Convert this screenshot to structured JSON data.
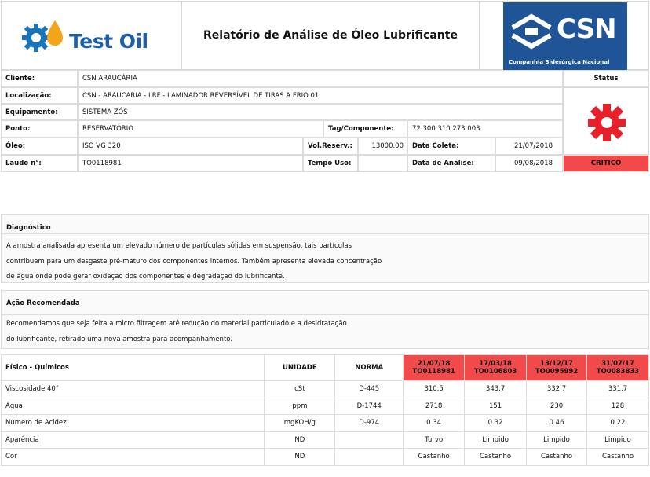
{
  "header": {
    "logo_text": "Test Oil",
    "title": "Relatório de Análise de Óleo Lubrificante",
    "csn_logo_text": "CSN",
    "csn_subtitle": "Companhia Siderúrgica Nacional"
  },
  "info": {
    "cliente_label": "Cliente:",
    "cliente_value": "CSN ARAUCÁRIA",
    "localizacao_label": "Localização:",
    "localizacao_value": "CSN - ARAUCARIA  - LRF - LAMINADOR REVERSÍVEL DE TIRAS A FRIO 01",
    "equipamento_label": "Equipamento:",
    "equipamento_value": "SISTEMA ZÓS",
    "ponto_label": "Ponto:",
    "ponto_value": "RESERVATÓRIO",
    "tag_label": "Tag/Componente:",
    "tag_value": "72 300 310 273 003",
    "oleo_label": "Óleo:",
    "oleo_value": "ISO VG 320",
    "volreserv_label": "Vol.Reserv.:",
    "volreserv_value": "13000.00",
    "data_coleta_label": "Data Coleta:",
    "data_coleta_value": "21/07/2018",
    "laudo_label": "Laudo n°:",
    "laudo_value": "TO0118981",
    "tempo_uso_label": "Tempo Uso:",
    "tempo_uso_value": "",
    "data_analise_label": "Data de Análise:",
    "data_analise_value": "09/08/2018",
    "status_label": "Status",
    "status_value": "CRITICO",
    "status_color": "#f24a4a"
  },
  "diagnostico": {
    "title": "Diagnóstico",
    "text": "A amostra analisada apresenta um elevado número de partículas sólidas em suspensão, tais partículas\ncontribuem para um desgaste pré-maturo dos componentes internos. Também apresenta elevada concentração\nde água onde pode gerar oxidação dos componentes e degradação do lubrificante."
  },
  "acao": {
    "title": "Ação Recomendada",
    "text": "Recomendamos que seja feita a micro filtragem até redução do material particulado e a desidratação\ndo lubrificante, retirado uma nova amostra para acompanhamento."
  },
  "results": {
    "col_param": "Físico - Químicos",
    "col_unit": "UNIDADE",
    "col_norm": "NORMA",
    "samples": [
      {
        "date": "21/07/18",
        "laudo": "TO0118981"
      },
      {
        "date": "17/03/18",
        "laudo": "TO0106803"
      },
      {
        "date": "13/12/17",
        "laudo": "TO0095992"
      },
      {
        "date": "31/07/17",
        "laudo": "TO0083833"
      }
    ],
    "rows": [
      {
        "name": "Viscosidade 40°",
        "unit": "cSt",
        "norm": "D-445",
        "values": [
          "310.5",
          "343.7",
          "332.7",
          "331.7"
        ]
      },
      {
        "name": "Água",
        "unit": "ppm",
        "norm": "D-1744",
        "values": [
          "2718",
          "151",
          "230",
          "128"
        ]
      },
      {
        "name": "Número de Acidez",
        "unit": "mgKOH/g",
        "norm": "D-974",
        "values": [
          "0.34",
          "0.32",
          "0.46",
          "0.22"
        ]
      },
      {
        "name": "Aparência",
        "unit": "ND",
        "norm": "",
        "values": [
          "Turvo",
          "Limpido",
          "Limpido",
          "Limpido"
        ]
      },
      {
        "name": "Cor",
        "unit": "ND",
        "norm": "",
        "values": [
          "Castanho",
          "Castanho",
          "Castanho",
          "Castanho"
        ]
      }
    ]
  }
}
